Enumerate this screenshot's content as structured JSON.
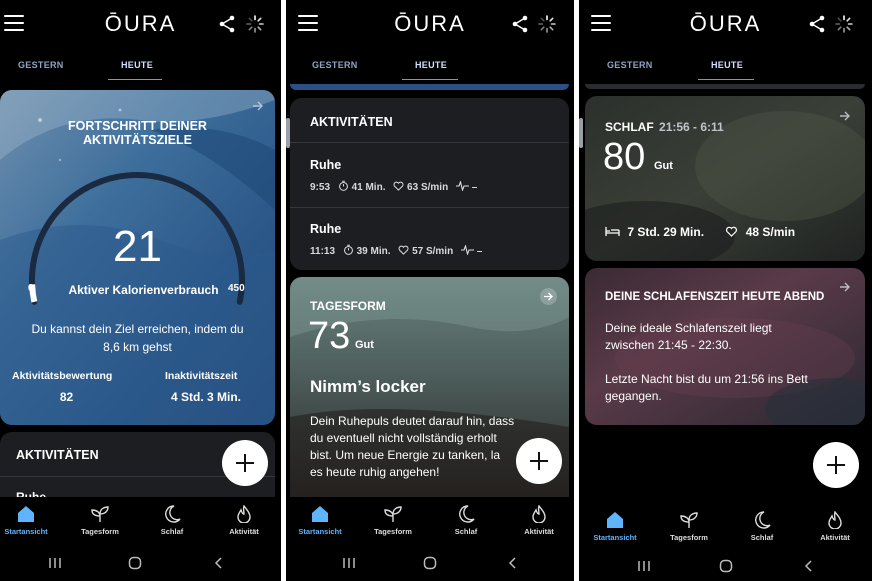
{
  "app": {
    "logo": "ŌURA"
  },
  "tabs": {
    "yesterday": "GESTERN",
    "today": "HEUTE"
  },
  "icons": {
    "menu": "hamburger-menu-icon",
    "share": "share-icon",
    "sync": "sync-spinner-icon",
    "add": "plus-icon",
    "open": "arrow-right-icon"
  },
  "colors": {
    "accent": "#5fb4ff",
    "card_dark": "#1c1e22",
    "fab": "#ffffff"
  },
  "nav": {
    "home": "Startansicht",
    "readiness": "Tagesform",
    "sleep": "Schlaf",
    "activity": "Aktivität"
  },
  "screen1": {
    "goal_title_l1": "FORTSCHRITT DEINER",
    "goal_title_l2": "AKTIVITÄTSZIELE",
    "gauge": {
      "value": "21",
      "min": "0",
      "max": "450",
      "label": "Aktiver Kalorienverbrauch",
      "progress": 0.047
    },
    "hint_l1": "Du kannst dein Ziel erreichen, indem du",
    "hint_l2": "8,6 km gehst",
    "score_label": "Aktivitätsbewertung",
    "score_value": "82",
    "inactive_label": "Inaktivitätszeit",
    "inactive_value": "4 Std. 3 Min.",
    "activities_title": "AKTIVITÄTEN",
    "activities_peek": "Ruhe"
  },
  "screen2": {
    "activities_title": "AKTIVITÄTEN",
    "items": [
      {
        "name": "Ruhe",
        "time": "9:53",
        "duration": "41 Min.",
        "hr": "63 S/min",
        "hrv": "–"
      },
      {
        "name": "Ruhe",
        "time": "11:13",
        "duration": "39 Min.",
        "hr": "57 S/min",
        "hrv": "–"
      }
    ],
    "readiness_title": "TAGESFORM",
    "readiness_score": "73",
    "readiness_rating": "Gut",
    "headline": "Nimm’s locker",
    "text_l1": "Dein Ruhepuls deutet darauf hin, dass",
    "text_l2": "du eventuell nicht vollständig erholt",
    "text_l3": "bist. Um neue Energie zu tanken, la",
    "text_l4": "es heute ruhig angehen!"
  },
  "screen3": {
    "sleep_title": "SCHLAF",
    "sleep_time": "21:56 - 6:11",
    "sleep_score": "80",
    "sleep_rating": "Gut",
    "sleep_duration": "7 Std. 29 Min.",
    "sleep_hr": "48 S/min",
    "bedtime_title": "DEINE SCHLAFENSZEIT HEUTE ABEND",
    "bedtime_l1": "Deine ideale Schlafenszeit liegt",
    "bedtime_l2": "zwischen 21:45 - 22:30.",
    "bedtime_l3": "Letzte Nacht bist du um 21:56 ins Bett",
    "bedtime_l4": "gegangen."
  }
}
